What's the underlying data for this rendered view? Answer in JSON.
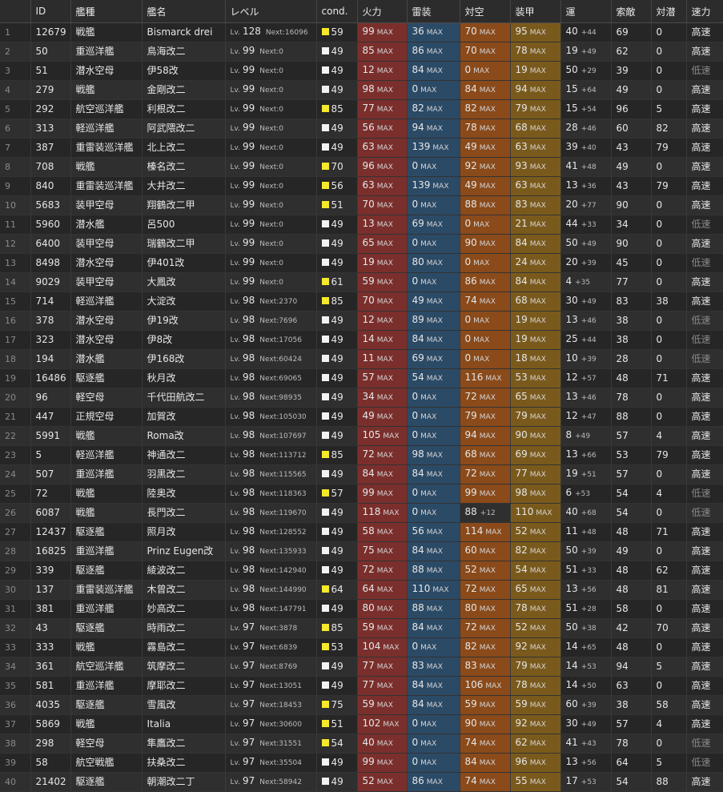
{
  "headers": [
    "",
    "ID",
    "艦種",
    "艦名",
    "レベル",
    "cond.",
    "火力",
    "雷装",
    "対空",
    "装甲",
    "運",
    "索敵",
    "対潜",
    "速力"
  ],
  "lv_label": "Lv.",
  "next_label": "Next:",
  "max_label": "MAX",
  "colors": {
    "firepower": "#7a2f2c",
    "torpedo": "#2b4a66",
    "aa": "#8a4a1a",
    "armor": "#7a5a1c",
    "cond_white": "#f2f2f2",
    "cond_yellow": "#f6e82a"
  },
  "rows": [
    {
      "n": "1",
      "id": "12679",
      "type": "戦艦",
      "name": "Bismarck drei",
      "lv": "128",
      "next": "16096",
      "cond": "59",
      "cy": true,
      "fp": "99",
      "fpm": true,
      "tp": "36",
      "tpm": true,
      "aa": "70",
      "aam": true,
      "aai": "",
      "ar": "95",
      "arm": true,
      "luck": "40",
      "li": "+44",
      "los": "69",
      "asw": "0",
      "spd": "高速"
    },
    {
      "n": "2",
      "id": "50",
      "type": "重巡洋艦",
      "name": "鳥海改二",
      "lv": "99",
      "next": "0",
      "cond": "49",
      "cy": false,
      "fp": "85",
      "fpm": true,
      "tp": "86",
      "tpm": true,
      "aa": "70",
      "aam": true,
      "aai": "",
      "ar": "78",
      "arm": true,
      "luck": "19",
      "li": "+49",
      "los": "62",
      "asw": "0",
      "spd": "高速"
    },
    {
      "n": "3",
      "id": "51",
      "type": "潜水空母",
      "name": "伊58改",
      "lv": "99",
      "next": "0",
      "cond": "49",
      "cy": false,
      "fp": "12",
      "fpm": true,
      "tp": "84",
      "tpm": true,
      "aa": "0",
      "aam": true,
      "aai": "",
      "ar": "19",
      "arm": true,
      "luck": "50",
      "li": "+29",
      "los": "39",
      "asw": "0",
      "spd": "低速"
    },
    {
      "n": "4",
      "id": "279",
      "type": "戦艦",
      "name": "金剛改二",
      "lv": "99",
      "next": "0",
      "cond": "49",
      "cy": false,
      "fp": "98",
      "fpm": true,
      "tp": "0",
      "tpm": true,
      "aa": "84",
      "aam": true,
      "aai": "",
      "ar": "94",
      "arm": true,
      "luck": "15",
      "li": "+64",
      "los": "49",
      "asw": "0",
      "spd": "高速"
    },
    {
      "n": "5",
      "id": "292",
      "type": "航空巡洋艦",
      "name": "利根改二",
      "lv": "99",
      "next": "0",
      "cond": "85",
      "cy": true,
      "fp": "77",
      "fpm": true,
      "tp": "82",
      "tpm": true,
      "aa": "82",
      "aam": true,
      "aai": "",
      "ar": "79",
      "arm": true,
      "luck": "15",
      "li": "+54",
      "los": "96",
      "asw": "5",
      "spd": "高速"
    },
    {
      "n": "6",
      "id": "313",
      "type": "軽巡洋艦",
      "name": "阿武隈改二",
      "lv": "99",
      "next": "0",
      "cond": "49",
      "cy": false,
      "fp": "56",
      "fpm": true,
      "tp": "94",
      "tpm": true,
      "aa": "78",
      "aam": true,
      "aai": "",
      "ar": "68",
      "arm": true,
      "luck": "28",
      "li": "+46",
      "los": "60",
      "asw": "82",
      "spd": "高速"
    },
    {
      "n": "7",
      "id": "387",
      "type": "重雷装巡洋艦",
      "name": "北上改二",
      "lv": "99",
      "next": "0",
      "cond": "49",
      "cy": false,
      "fp": "63",
      "fpm": true,
      "tp": "139",
      "tpm": true,
      "aa": "49",
      "aam": true,
      "aai": "",
      "ar": "63",
      "arm": true,
      "luck": "39",
      "li": "+40",
      "los": "43",
      "asw": "79",
      "spd": "高速"
    },
    {
      "n": "8",
      "id": "708",
      "type": "戦艦",
      "name": "榛名改二",
      "lv": "99",
      "next": "0",
      "cond": "70",
      "cy": true,
      "fp": "96",
      "fpm": true,
      "tp": "0",
      "tpm": true,
      "aa": "92",
      "aam": true,
      "aai": "",
      "ar": "93",
      "arm": true,
      "luck": "41",
      "li": "+48",
      "los": "49",
      "asw": "0",
      "spd": "高速"
    },
    {
      "n": "9",
      "id": "840",
      "type": "重雷装巡洋艦",
      "name": "大井改二",
      "lv": "99",
      "next": "0",
      "cond": "56",
      "cy": true,
      "fp": "63",
      "fpm": true,
      "tp": "139",
      "tpm": true,
      "aa": "49",
      "aam": true,
      "aai": "",
      "ar": "63",
      "arm": true,
      "luck": "13",
      "li": "+36",
      "los": "43",
      "asw": "79",
      "spd": "高速"
    },
    {
      "n": "10",
      "id": "5683",
      "type": "装甲空母",
      "name": "翔鶴改二甲",
      "lv": "99",
      "next": "0",
      "cond": "51",
      "cy": true,
      "fp": "70",
      "fpm": true,
      "tp": "0",
      "tpm": true,
      "aa": "88",
      "aam": true,
      "aai": "",
      "ar": "83",
      "arm": true,
      "luck": "20",
      "li": "+77",
      "los": "90",
      "asw": "0",
      "spd": "高速"
    },
    {
      "n": "11",
      "id": "5960",
      "type": "潜水艦",
      "name": "呂500",
      "lv": "99",
      "next": "0",
      "cond": "49",
      "cy": false,
      "fp": "13",
      "fpm": true,
      "tp": "69",
      "tpm": true,
      "aa": "0",
      "aam": true,
      "aai": "",
      "ar": "21",
      "arm": true,
      "luck": "44",
      "li": "+33",
      "los": "34",
      "asw": "0",
      "spd": "低速"
    },
    {
      "n": "12",
      "id": "6400",
      "type": "装甲空母",
      "name": "瑞鶴改二甲",
      "lv": "99",
      "next": "0",
      "cond": "49",
      "cy": false,
      "fp": "65",
      "fpm": true,
      "tp": "0",
      "tpm": true,
      "aa": "90",
      "aam": true,
      "aai": "",
      "ar": "84",
      "arm": true,
      "luck": "50",
      "li": "+49",
      "los": "90",
      "asw": "0",
      "spd": "高速"
    },
    {
      "n": "13",
      "id": "8498",
      "type": "潜水空母",
      "name": "伊401改",
      "lv": "99",
      "next": "0",
      "cond": "49",
      "cy": false,
      "fp": "19",
      "fpm": true,
      "tp": "80",
      "tpm": true,
      "aa": "0",
      "aam": true,
      "aai": "",
      "ar": "24",
      "arm": true,
      "luck": "20",
      "li": "+39",
      "los": "45",
      "asw": "0",
      "spd": "低速"
    },
    {
      "n": "14",
      "id": "9029",
      "type": "装甲空母",
      "name": "大鳳改",
      "lv": "99",
      "next": "0",
      "cond": "61",
      "cy": true,
      "fp": "59",
      "fpm": true,
      "tp": "0",
      "tpm": true,
      "aa": "86",
      "aam": true,
      "aai": "",
      "ar": "84",
      "arm": true,
      "luck": "4",
      "li": "+35",
      "los": "77",
      "asw": "0",
      "spd": "高速"
    },
    {
      "n": "15",
      "id": "714",
      "type": "軽巡洋艦",
      "name": "大淀改",
      "lv": "98",
      "next": "2370",
      "cond": "85",
      "cy": true,
      "fp": "70",
      "fpm": true,
      "tp": "49",
      "tpm": true,
      "aa": "74",
      "aam": true,
      "aai": "",
      "ar": "68",
      "arm": true,
      "luck": "30",
      "li": "+49",
      "los": "83",
      "asw": "38",
      "spd": "高速"
    },
    {
      "n": "16",
      "id": "378",
      "type": "潜水空母",
      "name": "伊19改",
      "lv": "98",
      "next": "7696",
      "cond": "49",
      "cy": false,
      "fp": "12",
      "fpm": true,
      "tp": "89",
      "tpm": true,
      "aa": "0",
      "aam": true,
      "aai": "",
      "ar": "19",
      "arm": true,
      "luck": "13",
      "li": "+46",
      "los": "38",
      "asw": "0",
      "spd": "低速"
    },
    {
      "n": "17",
      "id": "323",
      "type": "潜水空母",
      "name": "伊8改",
      "lv": "98",
      "next": "17056",
      "cond": "49",
      "cy": false,
      "fp": "14",
      "fpm": true,
      "tp": "84",
      "tpm": true,
      "aa": "0",
      "aam": true,
      "aai": "",
      "ar": "19",
      "arm": true,
      "luck": "25",
      "li": "+44",
      "los": "38",
      "asw": "0",
      "spd": "低速"
    },
    {
      "n": "18",
      "id": "194",
      "type": "潜水艦",
      "name": "伊168改",
      "lv": "98",
      "next": "60424",
      "cond": "49",
      "cy": false,
      "fp": "11",
      "fpm": true,
      "tp": "69",
      "tpm": true,
      "aa": "0",
      "aam": true,
      "aai": "",
      "ar": "18",
      "arm": true,
      "luck": "10",
      "li": "+39",
      "los": "28",
      "asw": "0",
      "spd": "低速"
    },
    {
      "n": "19",
      "id": "16486",
      "type": "駆逐艦",
      "name": "秋月改",
      "lv": "98",
      "next": "69065",
      "cond": "49",
      "cy": false,
      "fp": "57",
      "fpm": true,
      "tp": "54",
      "tpm": true,
      "aa": "116",
      "aam": true,
      "aai": "",
      "ar": "53",
      "arm": true,
      "luck": "12",
      "li": "+57",
      "los": "48",
      "asw": "71",
      "spd": "高速"
    },
    {
      "n": "20",
      "id": "96",
      "type": "軽空母",
      "name": "千代田航改二",
      "lv": "98",
      "next": "98935",
      "cond": "49",
      "cy": false,
      "fp": "34",
      "fpm": true,
      "tp": "0",
      "tpm": true,
      "aa": "72",
      "aam": true,
      "aai": "",
      "ar": "65",
      "arm": true,
      "luck": "13",
      "li": "+46",
      "los": "78",
      "asw": "0",
      "spd": "高速"
    },
    {
      "n": "21",
      "id": "447",
      "type": "正規空母",
      "name": "加賀改",
      "lv": "98",
      "next": "105030",
      "cond": "49",
      "cy": false,
      "fp": "49",
      "fpm": true,
      "tp": "0",
      "tpm": true,
      "aa": "79",
      "aam": true,
      "aai": "",
      "ar": "79",
      "arm": true,
      "luck": "12",
      "li": "+47",
      "los": "88",
      "asw": "0",
      "spd": "高速"
    },
    {
      "n": "22",
      "id": "5991",
      "type": "戦艦",
      "name": "Roma改",
      "lv": "98",
      "next": "107697",
      "cond": "49",
      "cy": false,
      "fp": "105",
      "fpm": true,
      "tp": "0",
      "tpm": true,
      "aa": "94",
      "aam": true,
      "aai": "",
      "ar": "90",
      "arm": true,
      "luck": "8",
      "li": "+49",
      "los": "57",
      "asw": "4",
      "spd": "高速"
    },
    {
      "n": "23",
      "id": "5",
      "type": "軽巡洋艦",
      "name": "神通改二",
      "lv": "98",
      "next": "113712",
      "cond": "85",
      "cy": true,
      "fp": "72",
      "fpm": true,
      "tp": "98",
      "tpm": true,
      "aa": "68",
      "aam": true,
      "aai": "",
      "ar": "69",
      "arm": true,
      "luck": "13",
      "li": "+66",
      "los": "53",
      "asw": "79",
      "spd": "高速"
    },
    {
      "n": "24",
      "id": "507",
      "type": "重巡洋艦",
      "name": "羽黒改二",
      "lv": "98",
      "next": "115565",
      "cond": "49",
      "cy": false,
      "fp": "84",
      "fpm": true,
      "tp": "84",
      "tpm": true,
      "aa": "72",
      "aam": true,
      "aai": "",
      "ar": "77",
      "arm": true,
      "luck": "19",
      "li": "+51",
      "los": "57",
      "asw": "0",
      "spd": "高速"
    },
    {
      "n": "25",
      "id": "72",
      "type": "戦艦",
      "name": "陸奥改",
      "lv": "98",
      "next": "118363",
      "cond": "57",
      "cy": true,
      "fp": "99",
      "fpm": true,
      "tp": "0",
      "tpm": true,
      "aa": "99",
      "aam": true,
      "aai": "",
      "ar": "98",
      "arm": true,
      "luck": "6",
      "li": "+53",
      "los": "54",
      "asw": "4",
      "spd": "低速"
    },
    {
      "n": "26",
      "id": "6087",
      "type": "戦艦",
      "name": "長門改二",
      "lv": "98",
      "next": "119670",
      "cond": "49",
      "cy": false,
      "fp": "118",
      "fpm": true,
      "tp": "0",
      "tpm": true,
      "aa": "88",
      "aam": false,
      "aai": "+12",
      "ar": "110",
      "arm": true,
      "luck": "40",
      "li": "+68",
      "los": "54",
      "asw": "0",
      "spd": "低速"
    },
    {
      "n": "27",
      "id": "12437",
      "type": "駆逐艦",
      "name": "照月改",
      "lv": "98",
      "next": "128552",
      "cond": "49",
      "cy": false,
      "fp": "58",
      "fpm": true,
      "tp": "56",
      "tpm": true,
      "aa": "114",
      "aam": true,
      "aai": "",
      "ar": "52",
      "arm": true,
      "luck": "11",
      "li": "+48",
      "los": "48",
      "asw": "71",
      "spd": "高速"
    },
    {
      "n": "28",
      "id": "16825",
      "type": "重巡洋艦",
      "name": "Prinz Eugen改",
      "lv": "98",
      "next": "135933",
      "cond": "49",
      "cy": false,
      "fp": "75",
      "fpm": true,
      "tp": "84",
      "tpm": true,
      "aa": "60",
      "aam": true,
      "aai": "",
      "ar": "82",
      "arm": true,
      "luck": "50",
      "li": "+39",
      "los": "49",
      "asw": "0",
      "spd": "高速"
    },
    {
      "n": "29",
      "id": "339",
      "type": "駆逐艦",
      "name": "綾波改二",
      "lv": "98",
      "next": "142940",
      "cond": "49",
      "cy": false,
      "fp": "72",
      "fpm": true,
      "tp": "88",
      "tpm": true,
      "aa": "52",
      "aam": true,
      "aai": "",
      "ar": "54",
      "arm": true,
      "luck": "51",
      "li": "+33",
      "los": "48",
      "asw": "62",
      "spd": "高速"
    },
    {
      "n": "30",
      "id": "137",
      "type": "重雷装巡洋艦",
      "name": "木曾改二",
      "lv": "98",
      "next": "144990",
      "cond": "64",
      "cy": true,
      "fp": "64",
      "fpm": true,
      "tp": "110",
      "tpm": true,
      "aa": "72",
      "aam": true,
      "aai": "",
      "ar": "65",
      "arm": true,
      "luck": "13",
      "li": "+56",
      "los": "48",
      "asw": "81",
      "spd": "高速"
    },
    {
      "n": "31",
      "id": "381",
      "type": "重巡洋艦",
      "name": "妙高改二",
      "lv": "98",
      "next": "147791",
      "cond": "49",
      "cy": false,
      "fp": "80",
      "fpm": true,
      "tp": "88",
      "tpm": true,
      "aa": "80",
      "aam": true,
      "aai": "",
      "ar": "78",
      "arm": true,
      "luck": "51",
      "li": "+28",
      "los": "58",
      "asw": "0",
      "spd": "高速"
    },
    {
      "n": "32",
      "id": "43",
      "type": "駆逐艦",
      "name": "時雨改二",
      "lv": "97",
      "next": "3878",
      "cond": "85",
      "cy": true,
      "fp": "59",
      "fpm": true,
      "tp": "84",
      "tpm": true,
      "aa": "72",
      "aam": true,
      "aai": "",
      "ar": "52",
      "arm": true,
      "luck": "50",
      "li": "+38",
      "los": "42",
      "asw": "70",
      "spd": "高速"
    },
    {
      "n": "33",
      "id": "333",
      "type": "戦艦",
      "name": "霧島改二",
      "lv": "97",
      "next": "6839",
      "cond": "53",
      "cy": true,
      "fp": "104",
      "fpm": true,
      "tp": "0",
      "tpm": true,
      "aa": "82",
      "aam": true,
      "aai": "",
      "ar": "92",
      "arm": true,
      "luck": "14",
      "li": "+65",
      "los": "48",
      "asw": "0",
      "spd": "高速"
    },
    {
      "n": "34",
      "id": "361",
      "type": "航空巡洋艦",
      "name": "筑摩改二",
      "lv": "97",
      "next": "8769",
      "cond": "49",
      "cy": false,
      "fp": "77",
      "fpm": true,
      "tp": "83",
      "tpm": true,
      "aa": "83",
      "aam": true,
      "aai": "",
      "ar": "79",
      "arm": true,
      "luck": "14",
      "li": "+53",
      "los": "94",
      "asw": "5",
      "spd": "高速"
    },
    {
      "n": "35",
      "id": "581",
      "type": "重巡洋艦",
      "name": "摩耶改二",
      "lv": "97",
      "next": "13051",
      "cond": "49",
      "cy": false,
      "fp": "77",
      "fpm": true,
      "tp": "84",
      "tpm": true,
      "aa": "106",
      "aam": true,
      "aai": "",
      "ar": "78",
      "arm": true,
      "luck": "14",
      "li": "+50",
      "los": "63",
      "asw": "0",
      "spd": "高速"
    },
    {
      "n": "36",
      "id": "4035",
      "type": "駆逐艦",
      "name": "雪風改",
      "lv": "97",
      "next": "18453",
      "cond": "75",
      "cy": true,
      "fp": "59",
      "fpm": true,
      "tp": "84",
      "tpm": true,
      "aa": "59",
      "aam": true,
      "aai": "",
      "ar": "59",
      "arm": true,
      "luck": "60",
      "li": "+39",
      "los": "38",
      "asw": "58",
      "spd": "高速"
    },
    {
      "n": "37",
      "id": "5869",
      "type": "戦艦",
      "name": "Italia",
      "lv": "97",
      "next": "30600",
      "cond": "51",
      "cy": true,
      "fp": "102",
      "fpm": true,
      "tp": "0",
      "tpm": true,
      "aa": "90",
      "aam": true,
      "aai": "",
      "ar": "92",
      "arm": true,
      "luck": "30",
      "li": "+49",
      "los": "57",
      "asw": "4",
      "spd": "高速"
    },
    {
      "n": "38",
      "id": "298",
      "type": "軽空母",
      "name": "隼鷹改二",
      "lv": "97",
      "next": "31551",
      "cond": "54",
      "cy": true,
      "fp": "40",
      "fpm": true,
      "tp": "0",
      "tpm": true,
      "aa": "74",
      "aam": true,
      "aai": "",
      "ar": "62",
      "arm": true,
      "luck": "41",
      "li": "+43",
      "los": "78",
      "asw": "0",
      "spd": "低速"
    },
    {
      "n": "39",
      "id": "58",
      "type": "航空戦艦",
      "name": "扶桑改二",
      "lv": "97",
      "next": "35504",
      "cond": "49",
      "cy": false,
      "fp": "99",
      "fpm": true,
      "tp": "0",
      "tpm": true,
      "aa": "84",
      "aam": true,
      "aai": "",
      "ar": "96",
      "arm": true,
      "luck": "13",
      "li": "+56",
      "los": "64",
      "asw": "5",
      "spd": "低速"
    },
    {
      "n": "40",
      "id": "21402",
      "type": "駆逐艦",
      "name": "朝潮改二丁",
      "lv": "97",
      "next": "58942",
      "cond": "49",
      "cy": false,
      "fp": "52",
      "fpm": true,
      "tp": "86",
      "tpm": true,
      "aa": "74",
      "aam": true,
      "aai": "",
      "ar": "55",
      "arm": true,
      "luck": "17",
      "li": "+53",
      "los": "54",
      "asw": "88",
      "spd": "高速"
    }
  ]
}
